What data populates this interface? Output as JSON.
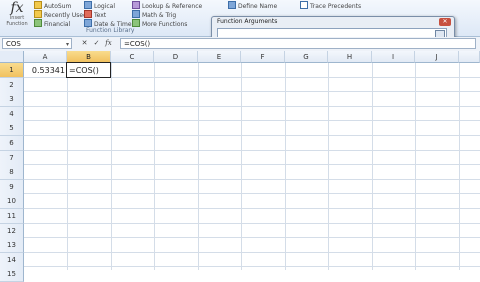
{
  "ribbon": {
    "insert_function": {
      "icon": "fx",
      "label": "Insert Function"
    },
    "library_col1": [
      "AutoSum",
      "Recently Used",
      "Financial"
    ],
    "library_col2": [
      "Logical",
      "Text",
      "Date & Time"
    ],
    "library_col3": [
      "Lookup & Reference",
      "Math & Trig",
      "More Functions"
    ],
    "group_label": "Function Library",
    "defined_names": "Define Name",
    "formula_auditing": "Trace Precedents"
  },
  "formula_bar": {
    "name_box": "COS",
    "formula": "=COS()"
  },
  "dialog": {
    "title": "Function Arguments",
    "close_glyph": "✕"
  },
  "grid": {
    "columns": [
      "A",
      "B",
      "C",
      "D",
      "E",
      "F",
      "G",
      "H",
      "I",
      "J"
    ],
    "rows": [
      "1",
      "2",
      "3",
      "4",
      "5",
      "6",
      "7",
      "8",
      "9",
      "10",
      "11",
      "12",
      "13",
      "14",
      "15"
    ],
    "a1_value": "0.53341",
    "b1_value": "=COS()"
  },
  "colors": {
    "ribbon_top": "#f4f8fd",
    "selected_header": "#f1c15f",
    "gridline": "#d4dde8"
  }
}
